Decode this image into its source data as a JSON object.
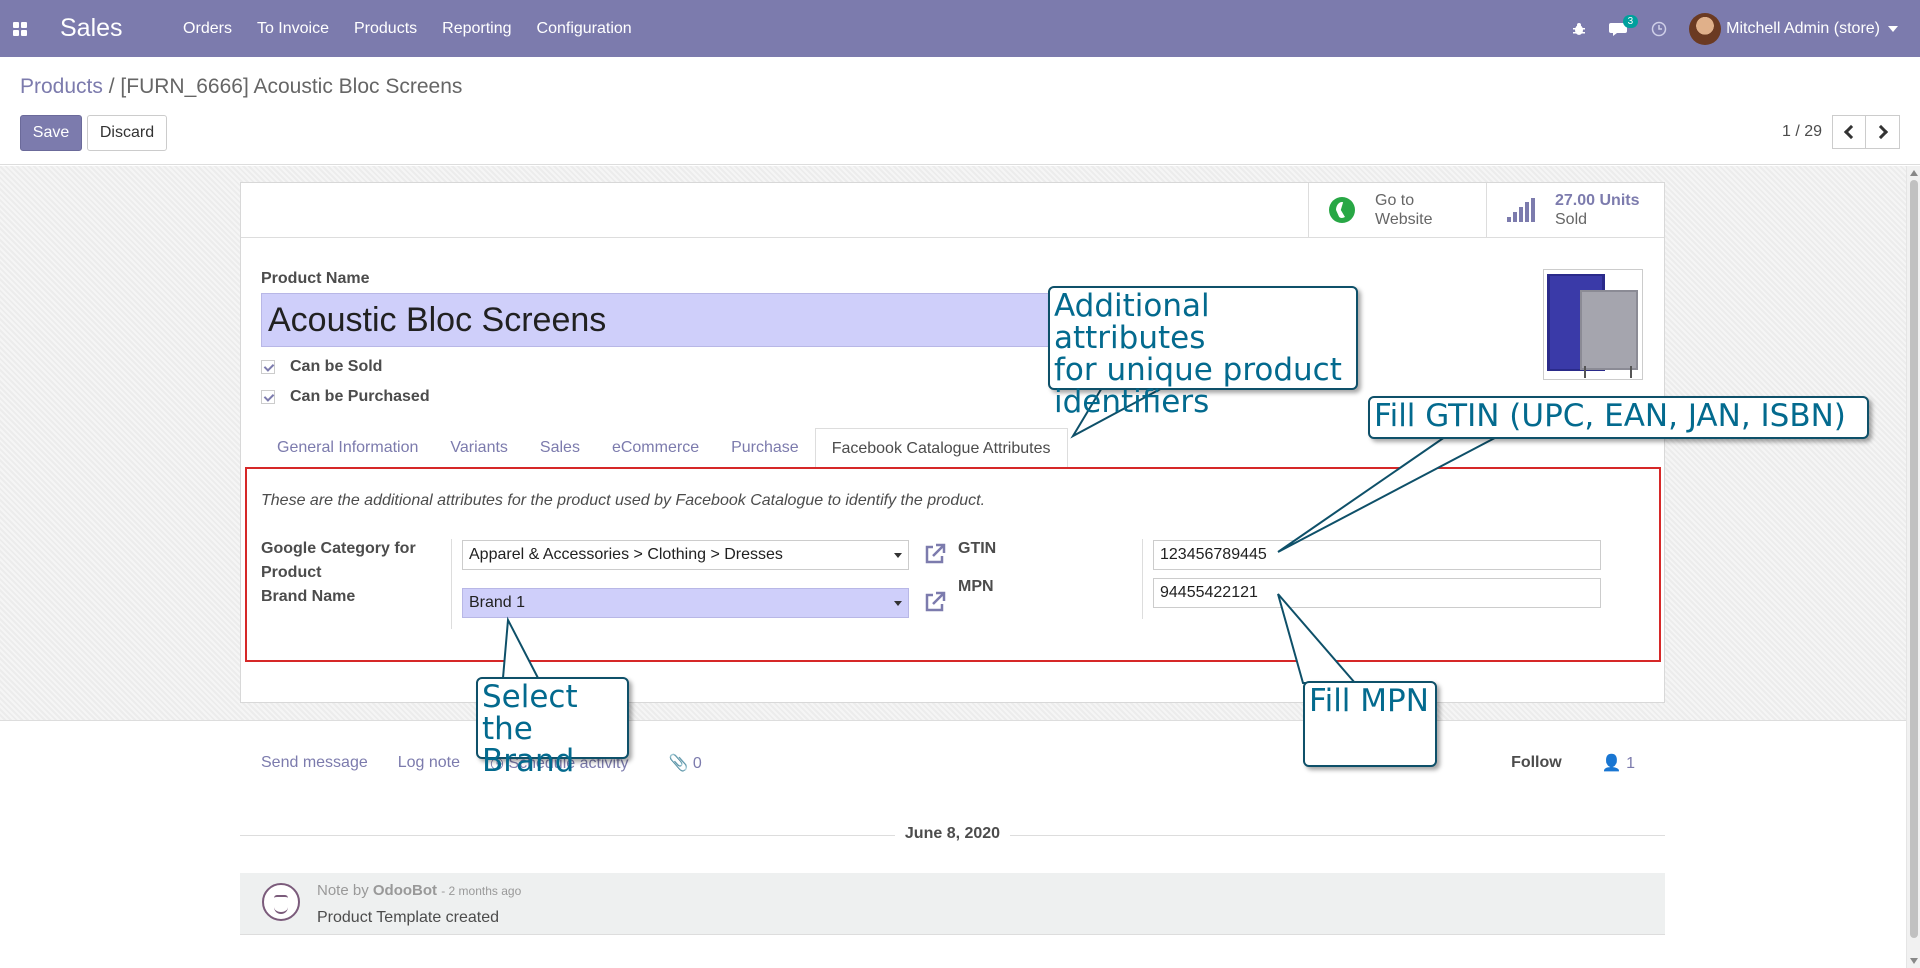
{
  "navbar": {
    "app_name": "Sales",
    "menu": [
      "Orders",
      "To Invoice",
      "Products",
      "Reporting",
      "Configuration"
    ],
    "message_count": "3",
    "user_name": "Mitchell Admin (store)"
  },
  "breadcrumb": {
    "parent": "Products",
    "separator": "/",
    "current": "[FURN_6666] Acoustic Bloc Screens"
  },
  "actions": {
    "save": "Save",
    "discard": "Discard"
  },
  "pager": {
    "value": "1 / 29"
  },
  "smart_buttons": {
    "website_line1": "Go to",
    "website_line2": "Website",
    "sold_value": "27.00 Units",
    "sold_label": "Sold"
  },
  "form": {
    "product_name_label": "Product Name",
    "product_name": "Acoustic Bloc Screens",
    "can_be_sold": "Can be Sold",
    "can_be_purchased": "Can be Purchased"
  },
  "tabs": [
    "General Information",
    "Variants",
    "Sales",
    "eCommerce",
    "Purchase",
    "Facebook Catalogue Attributes"
  ],
  "facebook_tab": {
    "description": "These are the additional attributes for the product used by Facebook Catalogue to identify the product.",
    "google_category_label_1": "Google Category for",
    "google_category_label_2": "Product",
    "google_category_value": "Apparel & Accessories > Clothing > Dresses",
    "brand_label": "Brand Name",
    "brand_value": "Brand 1",
    "gtin_label": "GTIN",
    "gtin_value": "123456789445",
    "mpn_label": "MPN",
    "mpn_value": "94455422121"
  },
  "chatter": {
    "send_message": "Send message",
    "log_note": "Log note",
    "schedule_activity": "Schedule activity",
    "attachments": "0",
    "follow": "Follow",
    "followers": "1",
    "date": "June 8, 2020",
    "message": {
      "prefix": "Note by",
      "author": "OdooBot",
      "ago": "- 2 months ago",
      "body": "Product Template created"
    }
  },
  "callouts": {
    "additional": [
      "Additional attributes",
      "for unique product",
      "identifiers"
    ],
    "gtin": "Fill GTIN (UPC, EAN, JAN, ISBN)",
    "brand": [
      "Select the",
      "Brand"
    ],
    "mpn": "Fill MPN"
  },
  "colors": {
    "navbar": "#7c7bad",
    "accent": "#7c7bad",
    "callout_text": "#036a8e",
    "highlight_border": "#d62828"
  }
}
